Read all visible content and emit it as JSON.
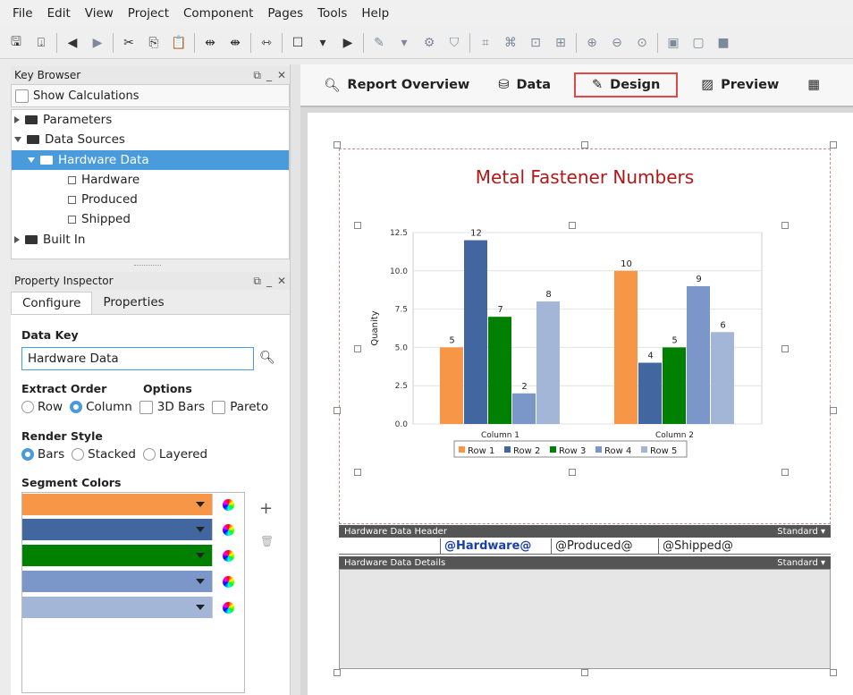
{
  "menu": [
    "File",
    "Edit",
    "View",
    "Project",
    "Component",
    "Pages",
    "Tools",
    "Help"
  ],
  "key_browser": {
    "title": "Key Browser",
    "show_calculations": "Show Calculations",
    "tree": {
      "parameters": "Parameters",
      "data_sources": "Data Sources",
      "hardware_data": "Hardware Data",
      "hardware": "Hardware",
      "produced": "Produced",
      "shipped": "Shipped",
      "built_in": "Built In"
    }
  },
  "property_inspector": {
    "title": "Property Inspector",
    "tabs": [
      "Configure",
      "Properties"
    ],
    "data_key_label": "Data Key",
    "data_key_value": "Hardware Data",
    "extract_order_label": "Extract Order",
    "options_label": "Options",
    "row": "Row",
    "column": "Column",
    "bars3d": "3D Bars",
    "pareto": "Pareto",
    "render_style_label": "Render Style",
    "bars": "Bars",
    "stacked": "Stacked",
    "layered": "Layered",
    "segment_colors_label": "Segment Colors",
    "segment_colors": [
      "#f79646",
      "#4267a0",
      "#008000",
      "#7b96c8",
      "#a4b6d8"
    ]
  },
  "report_tabs": {
    "overview": "Report Overview",
    "data": "Data",
    "design": "Design",
    "preview": "Preview"
  },
  "chart_data": {
    "type": "bar",
    "title": "Metal Fastener Numbers",
    "ylabel": "Quanity",
    "xlabel": "",
    "categories": [
      "Column 1",
      "Column 2"
    ],
    "series": [
      {
        "name": "Row 1",
        "values": [
          5,
          10
        ],
        "color": "#f79646"
      },
      {
        "name": "Row 2",
        "values": [
          12,
          4
        ],
        "color": "#4267a0"
      },
      {
        "name": "Row 3",
        "values": [
          7,
          5
        ],
        "color": "#008000"
      },
      {
        "name": "Row 4",
        "values": [
          2,
          9
        ],
        "color": "#7b96c8"
      },
      {
        "name": "Row 5",
        "values": [
          8,
          6
        ],
        "color": "#a4b6d8"
      }
    ],
    "yticks": [
      "0.0",
      "2.5",
      "5.0",
      "7.5",
      "10.0",
      "12.5"
    ],
    "ylim": [
      0,
      12.5
    ],
    "grid": true,
    "legend": "bottom"
  },
  "bands": {
    "header": "Hardware Data Header",
    "details": "Hardware Data Details",
    "standard": "Standard ▾",
    "fields": [
      "@Hardware@",
      "@Produced@",
      "@Shipped@"
    ]
  }
}
